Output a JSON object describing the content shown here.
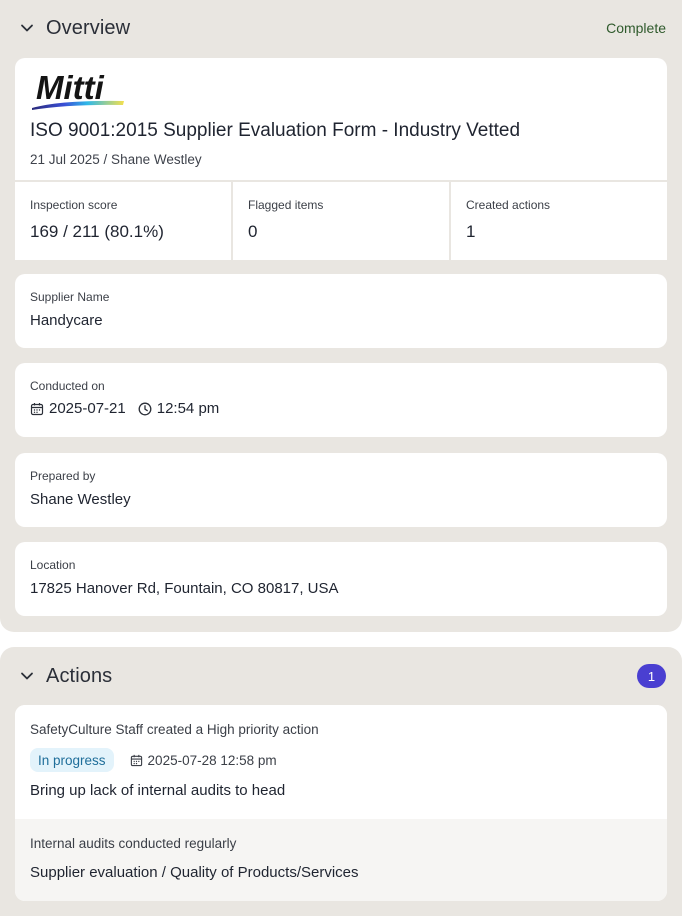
{
  "overview": {
    "title": "Overview",
    "status": "Complete",
    "logo_text": "Mitti",
    "doc_title": "ISO 9001:2015 Supplier Evaluation Form - Industry Vetted",
    "doc_meta": "21 Jul 2025 / Shane Westley",
    "stats": [
      {
        "label": "Inspection score",
        "value": "169 / 211 (80.1%)"
      },
      {
        "label": "Flagged items",
        "value": "0"
      },
      {
        "label": "Created actions",
        "value": "1"
      }
    ],
    "supplier": {
      "label": "Supplier Name",
      "value": "Handycare"
    },
    "conducted": {
      "label": "Conducted on",
      "date": "2025-07-21",
      "time": "12:54 pm"
    },
    "prepared": {
      "label": "Prepared by",
      "value": "Shane Westley"
    },
    "location": {
      "label": "Location",
      "value": "17825 Hanover Rd, Fountain, CO 80817, USA"
    }
  },
  "actions": {
    "title": "Actions",
    "count": "1",
    "item": {
      "creator": "SafetyCulture Staff created a High priority action",
      "status": "In progress",
      "due": "2025-07-28 12:58 pm",
      "title": "Bring up lack of internal audits to head",
      "question": "Internal audits conducted regularly",
      "path": "Supplier evaluation / Quality of Products/Services"
    }
  },
  "colors": {
    "section_bg": "#e9e6e1",
    "status_green": "#2f5a2c",
    "badge_purple": "#4a3fd1",
    "pill_bg": "#e3f3fb",
    "pill_text": "#1f6e9a"
  }
}
